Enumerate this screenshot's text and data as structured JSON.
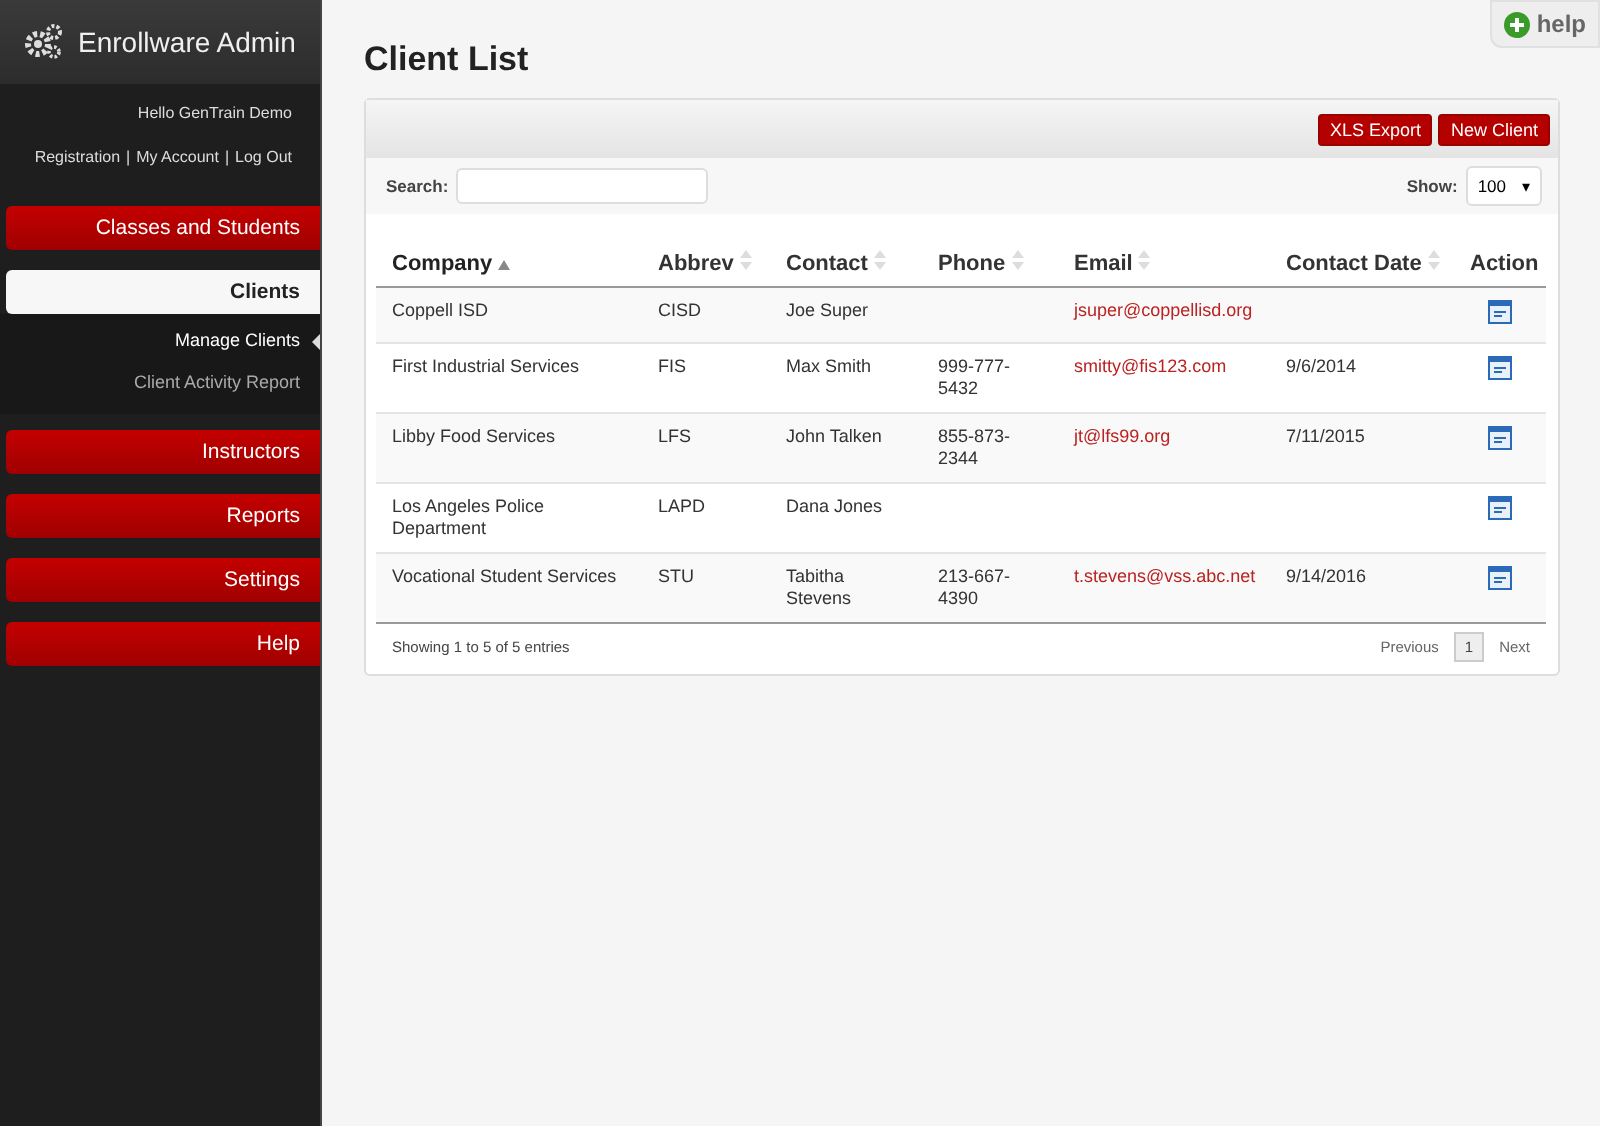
{
  "app": {
    "title": "Enrollware Admin",
    "greeting": "Hello GenTrain Demo",
    "links": [
      "Registration",
      "My Account",
      "Log Out"
    ],
    "separator": "|"
  },
  "nav": [
    {
      "label": "Classes and Students",
      "selected": false
    },
    {
      "label": "Clients",
      "selected": true,
      "children": [
        {
          "label": "Manage Clients",
          "selected": true
        },
        {
          "label": "Client Activity Report",
          "selected": false
        }
      ]
    },
    {
      "label": "Instructors",
      "selected": false
    },
    {
      "label": "Reports",
      "selected": false
    },
    {
      "label": "Settings",
      "selected": false
    },
    {
      "label": "Help",
      "selected": false
    }
  ],
  "help": "help",
  "page": {
    "title": "Client List"
  },
  "toolbar": {
    "buttons": [
      "XLS Export",
      "New Client"
    ]
  },
  "search": {
    "label": "Search:"
  },
  "show": {
    "label": "Show:",
    "value": "100",
    "arrow": "▾"
  },
  "table": {
    "columns": [
      {
        "label": "Company",
        "sortable": true,
        "sorted": true
      },
      {
        "label": "Abbrev",
        "sortable": true,
        "sorted": false
      },
      {
        "label": "Contact",
        "sortable": true,
        "sorted": false
      },
      {
        "label": "Phone",
        "sortable": true,
        "sorted": false
      },
      {
        "label": "Email",
        "sortable": true,
        "sorted": false
      },
      {
        "label": "Contact Date",
        "sortable": true,
        "sorted": false
      },
      {
        "label": "Action",
        "sortable": false
      }
    ],
    "rows": [
      {
        "company": "Coppell ISD",
        "abbrev": "CISD",
        "contact": "Joe Super",
        "phone": "",
        "email": "jsuper@coppellisd.org",
        "date": ""
      },
      {
        "company": "First Industrial Services",
        "abbrev": "FIS",
        "contact": "Max Smith",
        "phone": "999-777-5432",
        "email": "smitty@fis123.com",
        "date": "9/6/2014"
      },
      {
        "company": "Libby Food Services",
        "abbrev": "LFS",
        "contact": "John Talken",
        "phone": "855-873-2344",
        "email": "jt@lfs99.org",
        "date": "7/11/2015"
      },
      {
        "company": "Los Angeles Police Department",
        "abbrev": "LAPD",
        "contact": "Dana Jones",
        "phone": "",
        "email": "",
        "date": ""
      },
      {
        "company": "Vocational Student Services",
        "abbrev": "STU",
        "contact": "Tabitha Stevens",
        "phone": "213-667-4390",
        "email": "t.stevens@vss.abc.net",
        "date": "9/14/2016"
      }
    ]
  },
  "footer": {
    "info": "Showing 1 to 5 of 5 entries",
    "previous": "Previous",
    "pages": [
      {
        "label": "1",
        "selected": true
      }
    ],
    "next": "Next"
  }
}
